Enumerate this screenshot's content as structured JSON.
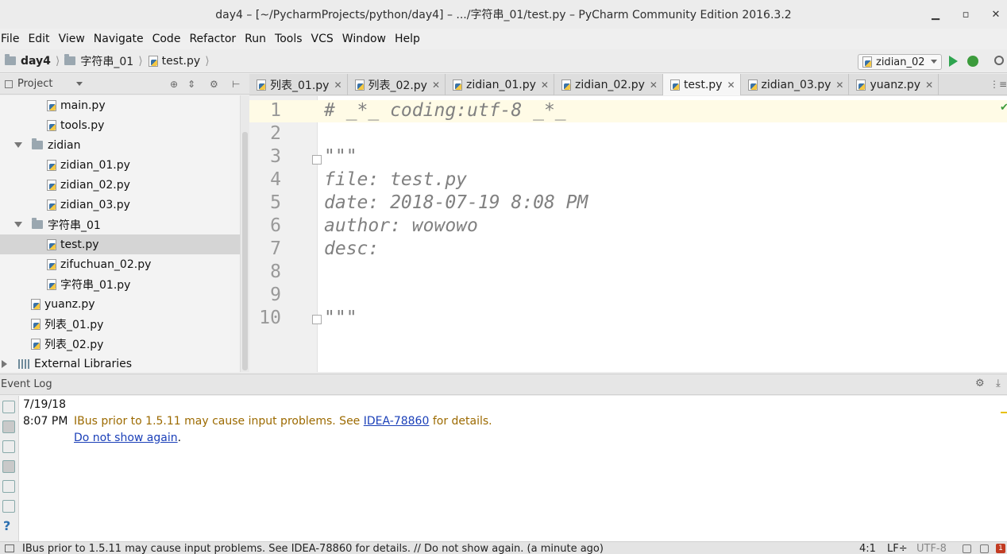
{
  "window": {
    "title": "day4 – [~/PycharmProjects/python/day4] – .../字符串_01/test.py – PyCharm Community Edition 2016.3.2",
    "min": "▁",
    "max": "▫",
    "close": "✕"
  },
  "menu": [
    "File",
    "Edit",
    "View",
    "Navigate",
    "Code",
    "Refactor",
    "Run",
    "Tools",
    "VCS",
    "Window",
    "Help"
  ],
  "breadcrumb": {
    "project": "day4",
    "folder": "字符串_01",
    "file": "test.py",
    "sep": "⟩"
  },
  "run_config": {
    "selected": "zidian_02"
  },
  "project_panel": {
    "label": "Project",
    "tree": [
      {
        "label": "main.py",
        "type": "py"
      },
      {
        "label": "tools.py",
        "type": "py"
      },
      {
        "label": "zidian",
        "type": "folder"
      },
      {
        "label": "zidian_01.py",
        "type": "py"
      },
      {
        "label": "zidian_02.py",
        "type": "py"
      },
      {
        "label": "zidian_03.py",
        "type": "py"
      },
      {
        "label": "字符串_01",
        "type": "folder"
      },
      {
        "label": "test.py",
        "type": "py",
        "selected": true
      },
      {
        "label": "zifuchuan_02.py",
        "type": "py"
      },
      {
        "label": "字符串_01.py",
        "type": "py"
      },
      {
        "label": "yuanz.py",
        "type": "py"
      },
      {
        "label": "列表_01.py",
        "type": "py"
      },
      {
        "label": "列表_02.py",
        "type": "py"
      },
      {
        "label": "External Libraries",
        "type": "lib"
      }
    ]
  },
  "tabs": [
    {
      "label": "列表_01.py",
      "active": false
    },
    {
      "label": "列表_02.py",
      "active": false
    },
    {
      "label": "zidian_01.py",
      "active": false
    },
    {
      "label": "zidian_02.py",
      "active": false
    },
    {
      "label": "test.py",
      "active": true
    },
    {
      "label": "zidian_03.py",
      "active": false
    },
    {
      "label": "yuanz.py",
      "active": false
    }
  ],
  "editor": {
    "lines": [
      {
        "n": "1",
        "text": "# _*_ coding:utf-8 _*_"
      },
      {
        "n": "2",
        "text": ""
      },
      {
        "n": "3",
        "text": "\"\"\""
      },
      {
        "n": "4",
        "text": "file: test.py"
      },
      {
        "n": "5",
        "text": "date: 2018-07-19 8:08 PM"
      },
      {
        "n": "6",
        "text": "author: wowowo"
      },
      {
        "n": "7",
        "text": "desc:"
      },
      {
        "n": "8",
        "text": ""
      },
      {
        "n": "9",
        "text": ""
      },
      {
        "n": "10",
        "text": "\"\"\""
      }
    ]
  },
  "event_log": {
    "title": "Event Log",
    "date": "7/19/18",
    "time": "8:07 PM",
    "msg_before": "IBus prior to 1.5.11 may cause input problems. See ",
    "msg_link": "IDEA-78860",
    "msg_after": " for details.",
    "dismiss": "Do not show again",
    "dismiss_dot": "."
  },
  "status": {
    "text": "IBus prior to 1.5.11 may cause input problems. See IDEA-78860 for details. // Do not show again. (a minute ago)",
    "position": "4:1",
    "line_sep": "LF÷",
    "encoding": "UTF-8",
    "badge": "1"
  },
  "colors": {
    "accent": "#1a3fb8",
    "warning": "#9c6a00",
    "run": "#2ea44f"
  }
}
